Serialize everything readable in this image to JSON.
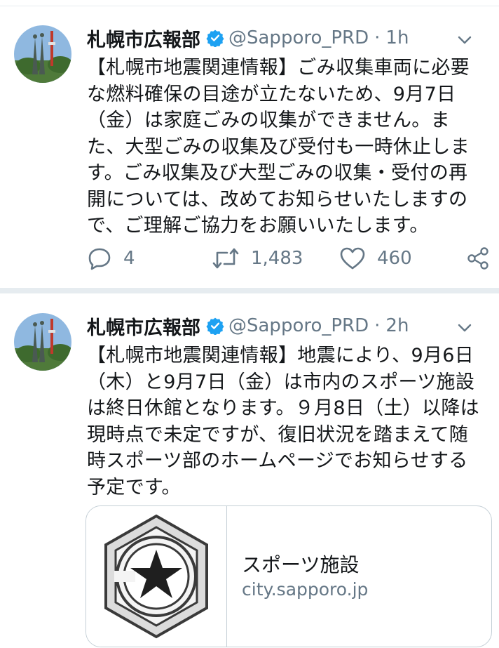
{
  "tweets": [
    {
      "name": "札幌市広報部",
      "handle": "@Sapporo_PRD",
      "separator": "·",
      "time": "1h",
      "text_lines": [
        "【札幌市地震関連情報】ごみ収集車両に必要",
        "な燃料確保の目途が立たないため、9月7日",
        "（金）は家庭ごみの収集ができません。ま",
        "た、大型ごみの収集及び受付も一時休止しま",
        "す。ごみ収集及び大型ごみの収集・受付の再",
        "開については、改めてお知らせいたしますの",
        "で、ご理解ご協力をお願いいたします。"
      ],
      "replies": "4",
      "retweets": "1,483",
      "likes": "460"
    },
    {
      "name": "札幌市広報部",
      "handle": "@Sapporo_PRD",
      "separator": "·",
      "time": "2h",
      "text_lines": [
        "【札幌市地震関連情報】地震により、9月6日",
        "（木）と9月7日（金）は市内のスポーツ施設",
        "は終日休館となります。９月8日（土）以降は",
        "現時点で未定ですが、復旧状況を踏まえて随",
        "時スポーツ部のホームページでお知らせする",
        "予定です。"
      ],
      "card": {
        "title": "スポーツ施設",
        "domain": "city.sapporo.jp"
      }
    }
  ],
  "colors": {
    "text": "#14171a",
    "secondary": "#657786",
    "verified": "#1da1f2",
    "divider": "#e6ecf0"
  },
  "icons": [
    "verified-badge-icon",
    "chevron-down-icon",
    "reply-icon",
    "retweet-icon",
    "like-icon",
    "share-icon",
    "sapporo-emblem-icon"
  ]
}
